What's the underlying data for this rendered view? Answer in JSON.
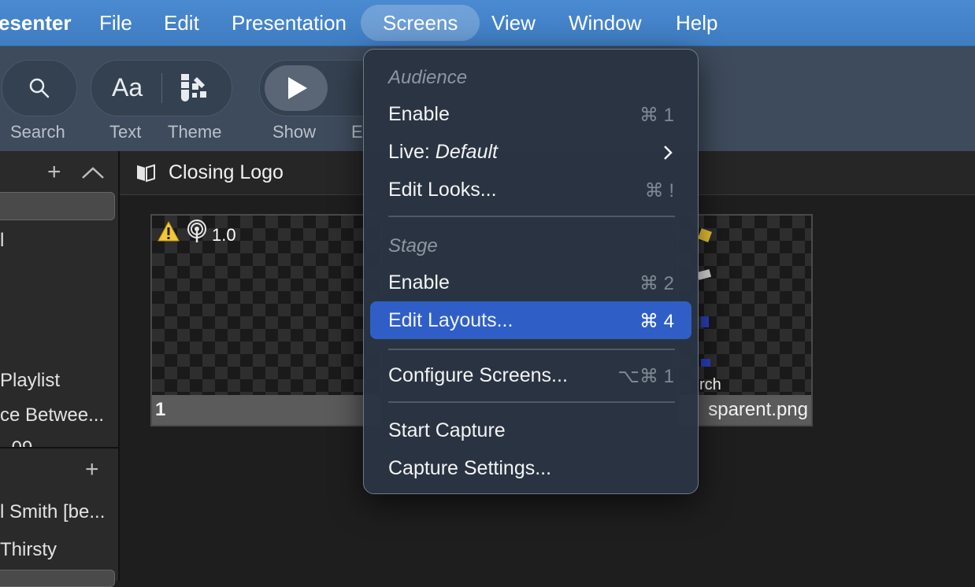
{
  "menubar": {
    "app_name": "esenter",
    "items": [
      "File",
      "Edit",
      "Presentation",
      "Screens",
      "View",
      "Window",
      "Help"
    ],
    "active": "Screens"
  },
  "toolbar": {
    "buttons": [
      {
        "label": "Search",
        "icon": "search-icon"
      },
      {
        "label": "Text",
        "icon": "text-aa-icon"
      },
      {
        "label": "Theme",
        "icon": "theme-icon"
      },
      {
        "label": "Show",
        "icon": "play-icon"
      },
      {
        "label": "E",
        "icon": "edit-icon"
      }
    ],
    "text_glyph": "Aa"
  },
  "sidebar": {
    "items": [
      "l",
      "Playlist",
      "ce Betwee...",
      "",
      "l Smith [be...",
      "Thirsty"
    ],
    "partial_row": "- 09"
  },
  "main": {
    "title": "Closing Logo",
    "slides": [
      {
        "number": "1",
        "badge": "1.0",
        "label": ""
      },
      {
        "number": "",
        "badge": "",
        "label": "sparent.png",
        "overlay_text": "rch"
      }
    ]
  },
  "menu": {
    "sections": [
      {
        "header": "Audience",
        "items": [
          {
            "label": "Enable",
            "shortcut": "⌘ 1"
          },
          {
            "label_prefix": "Live: ",
            "label_em": "Default",
            "submenu": true
          },
          {
            "label": "Edit Looks...",
            "shortcut": "⌘ !"
          }
        ]
      },
      {
        "header": "Stage",
        "items": [
          {
            "label": "Enable",
            "shortcut": "⌘ 2"
          },
          {
            "label": "Edit Layouts...",
            "shortcut": "⌘ 4",
            "highlighted": true
          }
        ]
      },
      {
        "items": [
          {
            "label": "Configure Screens...",
            "shortcut": "⌥⌘ 1"
          }
        ]
      },
      {
        "items": [
          {
            "label": "Start Capture"
          },
          {
            "label": "Capture Settings..."
          }
        ]
      }
    ]
  },
  "colors": {
    "menubar": "#4287cd",
    "highlight": "#2f5fc6",
    "toolbar": "#3e4b5c"
  }
}
